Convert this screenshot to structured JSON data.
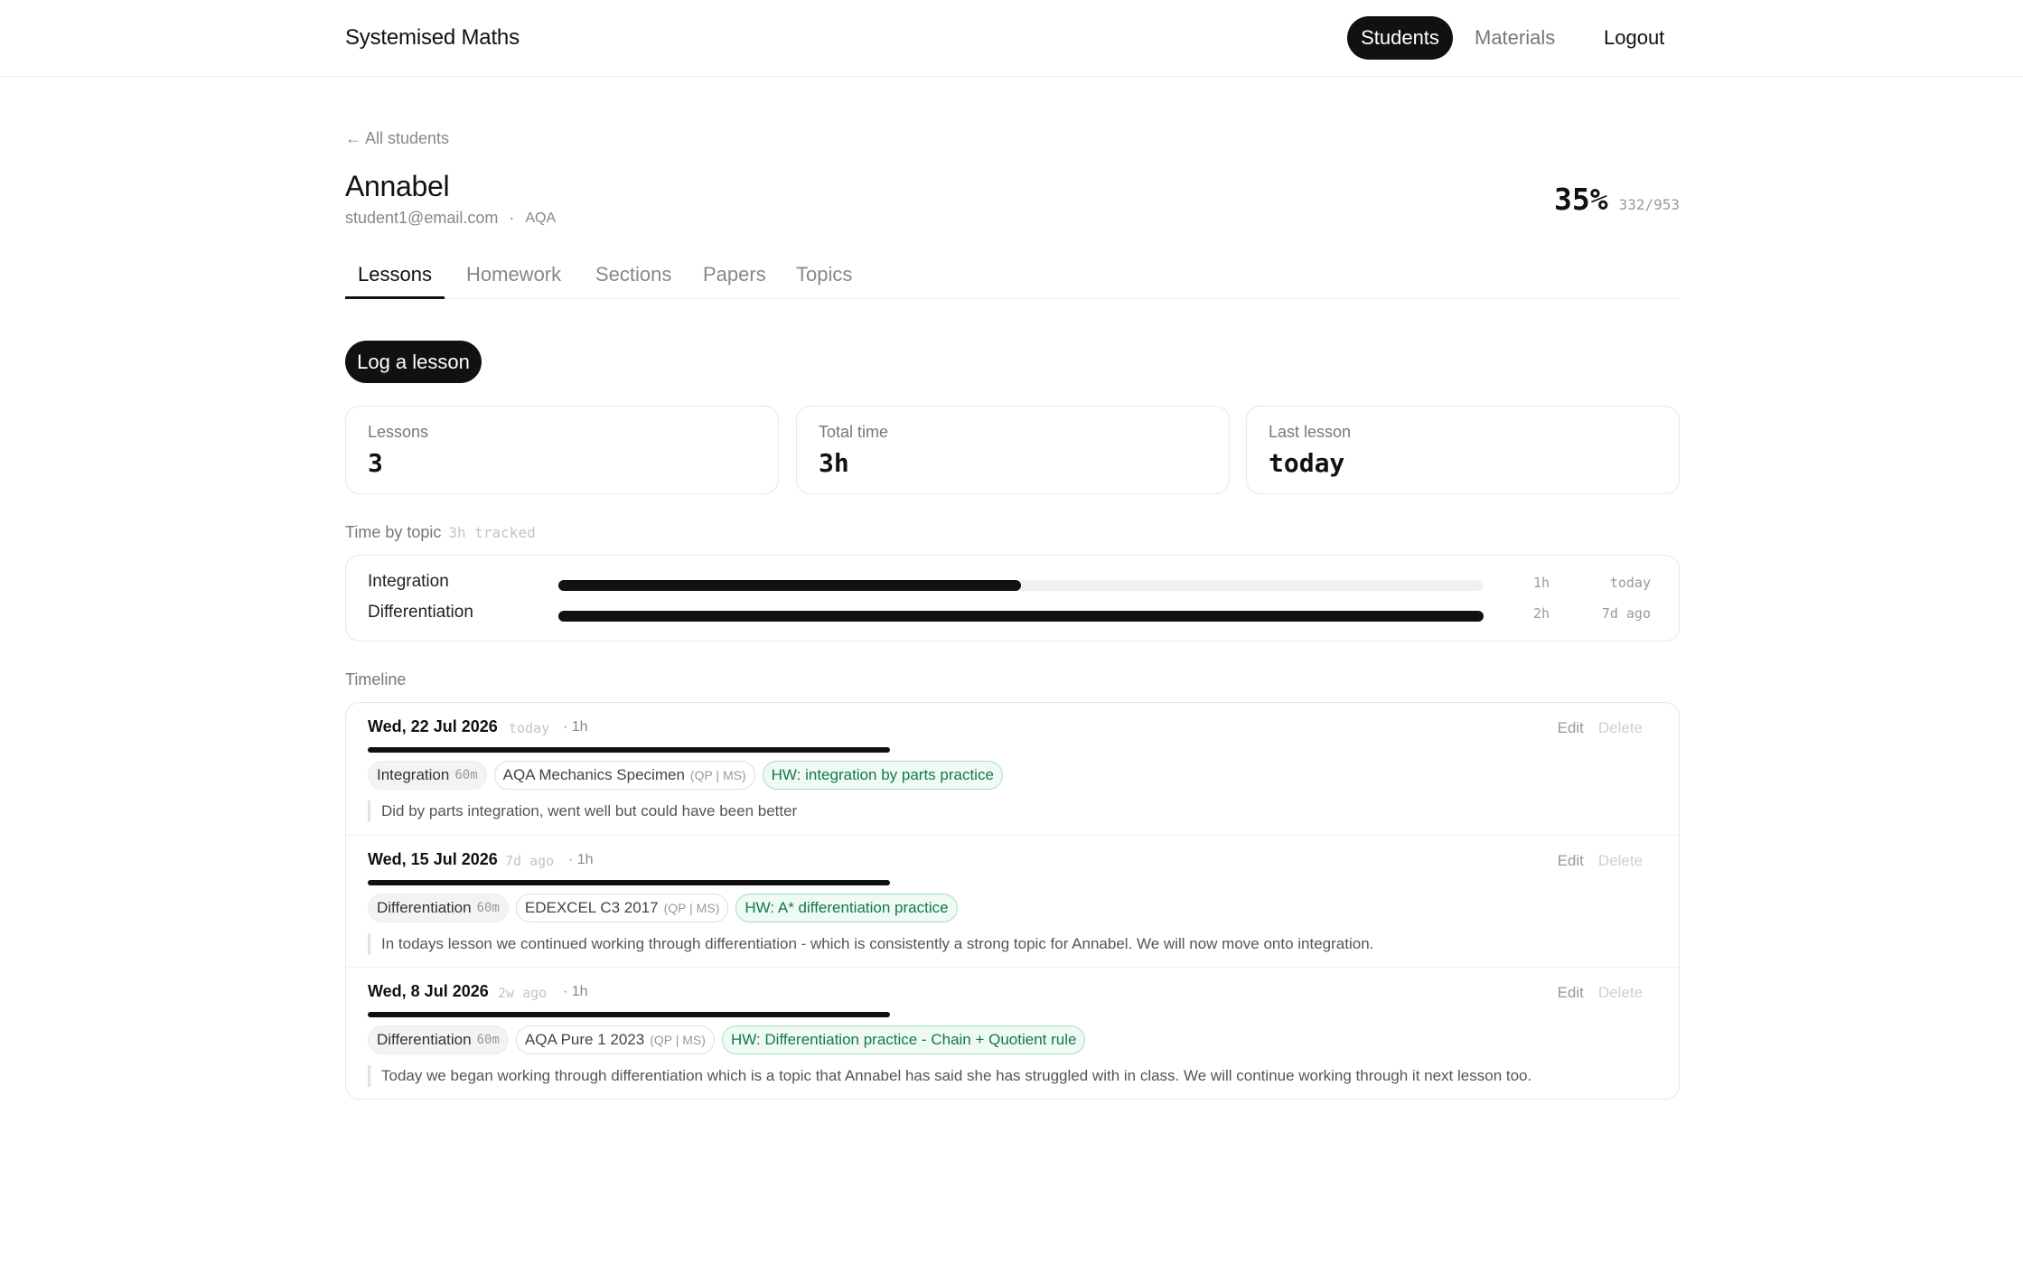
{
  "header": {
    "brand": "Systemised Maths",
    "nav": {
      "students": "Students",
      "materials": "Materials",
      "logout": "Logout"
    }
  },
  "student": {
    "back_link": "← All students",
    "name": "Annabel",
    "email": "student1@email.com",
    "separator": "·",
    "board": "AQA",
    "progress_pct": "35%",
    "progress_frac": "332/953"
  },
  "tabs": [
    "Lessons",
    "Homework",
    "Sections",
    "Papers",
    "Topics"
  ],
  "actions": {
    "log_lesson": "Log a lesson"
  },
  "stats": [
    {
      "label": "Lessons",
      "value": "3"
    },
    {
      "label": "Total time",
      "value": "3h"
    },
    {
      "label": "Last lesson",
      "value": "today"
    }
  ],
  "time_by_topic": {
    "label": "Time by topic",
    "tracked": "3h tracked",
    "rows": [
      {
        "topic": "Integration",
        "hours": "1h",
        "when": "today",
        "fraction": 0.5
      },
      {
        "topic": "Differentiation",
        "hours": "2h",
        "when": "7d ago",
        "fraction": 1.0
      }
    ]
  },
  "timeline": {
    "label": "Timeline",
    "edit_label": "Edit",
    "delete_label": "Delete",
    "entries": [
      {
        "date": "Wed, 22 Jul 2026",
        "relative": "today",
        "duration": "· 1h",
        "topic": "Integration",
        "topic_mins": "60m",
        "paper": "AQA Mechanics Specimen",
        "paper_tag": "(QP | MS)",
        "homework": "HW: integration by parts practice",
        "note": "Did by parts integration, went well but could have been better"
      },
      {
        "date": "Wed, 15 Jul 2026",
        "relative": "7d ago",
        "duration": "· 1h",
        "topic": "Differentiation",
        "topic_mins": "60m",
        "paper": "EDEXCEL C3 2017",
        "paper_tag": "(QP | MS)",
        "homework": "HW: A* differentiation practice",
        "note": "In todays lesson we continued working through differentiation - which is consistently a strong topic for Annabel. We will now move onto integration."
      },
      {
        "date": "Wed, 8 Jul 2026",
        "relative": "2w ago",
        "duration": "· 1h",
        "topic": "Differentiation",
        "topic_mins": "60m",
        "paper": "AQA Pure 1 2023",
        "paper_tag": "(QP | MS)",
        "homework": "HW: Differentiation practice - Chain + Quotient rule",
        "note": "Today we began working through differentiation which is a topic that Annabel has said she has struggled with in class. We will continue working through it next lesson too."
      }
    ]
  }
}
